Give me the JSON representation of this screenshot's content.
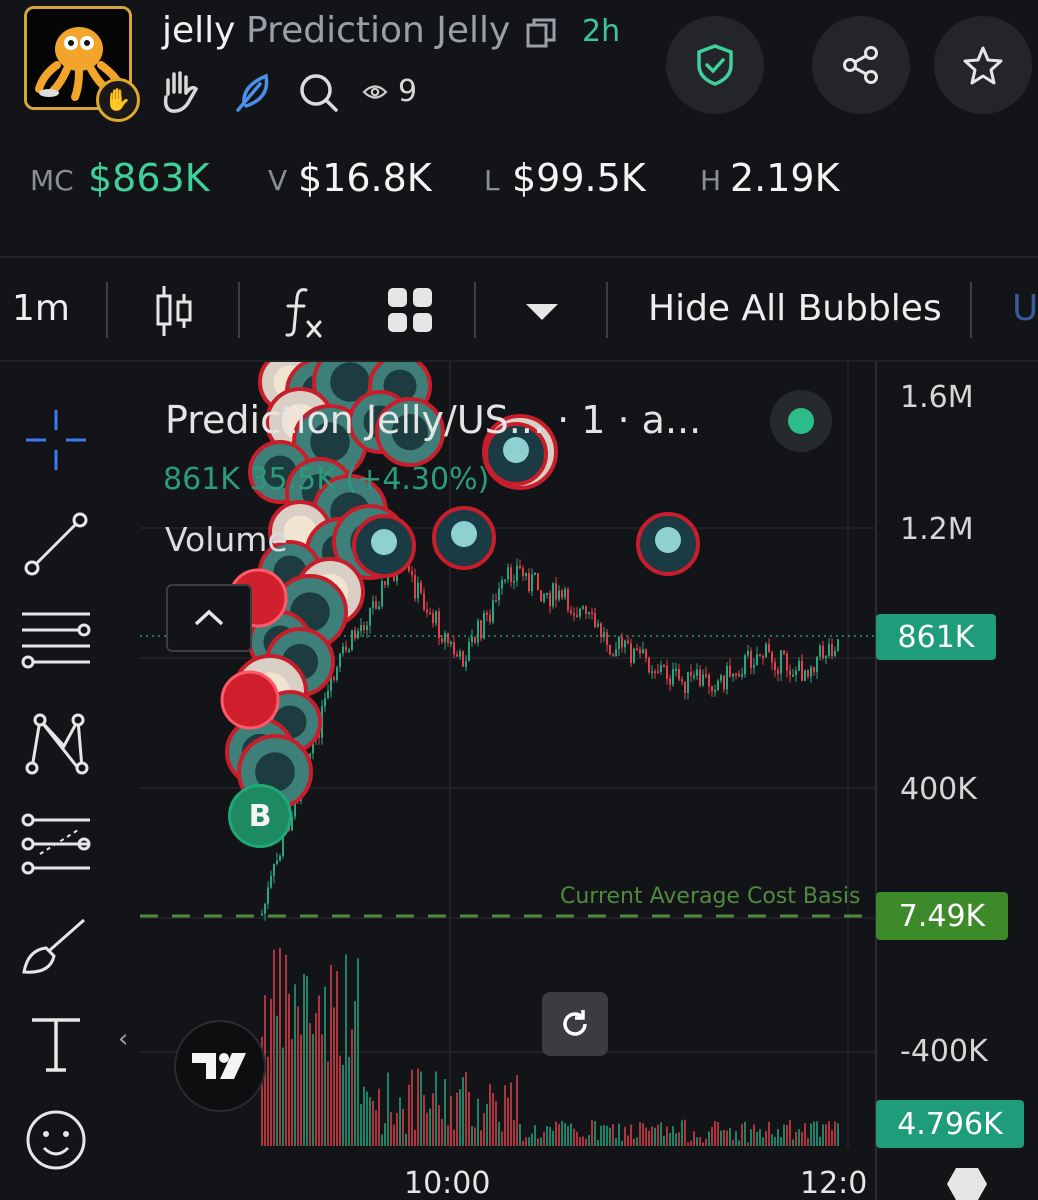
{
  "header": {
    "symbol": "jelly",
    "name": "Prediction Jelly",
    "age": "2h",
    "watchers": "9"
  },
  "stats": [
    {
      "label": "MC",
      "value": "$863K"
    },
    {
      "label": "V",
      "value": "$16.8K"
    },
    {
      "label": "L",
      "value": "$99.5K"
    },
    {
      "label": "H",
      "value": "2.19K"
    }
  ],
  "toolbar": {
    "interval": "1m",
    "hide_bubbles": "Hide All Bubbles",
    "cut_label": "U"
  },
  "chart": {
    "title": "Prediction Jelly/US... · 1 · a...",
    "ohlc": "861K  35.5K (+4.30%)",
    "volume_label": "Volume",
    "cost_basis_label": "Current Average Cost Basis",
    "y_labels": [
      "1.6M",
      "1.2M",
      "400K",
      "-400K"
    ],
    "price_tag": "861K",
    "cost_tag": "7.49K",
    "volume_tag": "4.796K",
    "x_labels": [
      "10:00",
      "12:0"
    ],
    "bubble_letter": "B",
    "colors": {
      "up": "#26a77f",
      "down": "#e0424c",
      "cost": "#4f8a3d"
    }
  },
  "chart_data": {
    "type": "candlestick",
    "title": "Prediction Jelly/US... · 1 · a...",
    "y_ticks": [
      "1.6M",
      "1.2M",
      "400K"
    ],
    "x_ticks": [
      "10:00",
      "12:0"
    ],
    "last_price": "861K",
    "cost_basis": "7.49K",
    "volume_last": "4.796K",
    "trend_key_points": [
      {
        "x": "start",
        "y": 7490
      },
      {
        "x": "~9:45",
        "y": 1000000
      },
      {
        "x": "10:00",
        "y": 800000
      },
      {
        "x": "~10:30",
        "y": 950000
      },
      {
        "x": "~11:15",
        "y": 700000
      },
      {
        "x": "~12:00",
        "y": 861000
      }
    ]
  }
}
